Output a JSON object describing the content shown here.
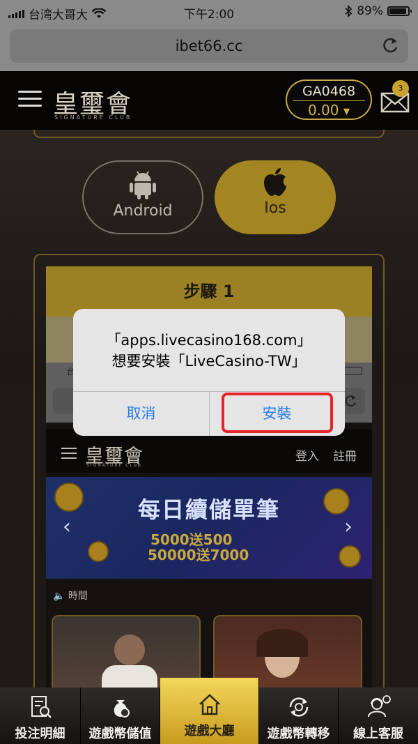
{
  "status_bar": {
    "carrier": "台湾大哥大",
    "time": "下午2:00",
    "battery": "89%"
  },
  "browser": {
    "url": "ibet66.cc"
  },
  "header": {
    "logo": "皇璽會",
    "logo_sub": "SIGNATURE CLUB",
    "account_id": "GA0468",
    "balance": "0.00",
    "mail_count": "3"
  },
  "platform_buttons": [
    {
      "label": "Android",
      "icon": "android-icon"
    },
    {
      "label": "Ios",
      "icon": "apple-icon"
    }
  ],
  "step_title": "步驟 1",
  "inner_screenshot": {
    "status_left": "台",
    "logo": "皇璽會",
    "logo_sub": "SIGNATURE CLUB",
    "login": "登入",
    "register": "註冊",
    "banner_title": "每日續儲單筆",
    "banner_line1": "5000送500",
    "banner_line2": "50000送7000",
    "notice": "時間"
  },
  "dialog": {
    "line1": "「apps.livecasino168.com」",
    "line2": "想要安裝「LiveCasino-TW」",
    "cancel": "取消",
    "install": "安裝"
  },
  "tabs": [
    {
      "label": "投注明細",
      "icon": "bet-detail-icon",
      "active": false
    },
    {
      "label": "遊戲幣儲值",
      "icon": "deposit-icon",
      "active": false
    },
    {
      "label": "遊戲大廳",
      "icon": "home-icon",
      "active": true
    },
    {
      "label": "遊戲幣轉移",
      "icon": "transfer-icon",
      "active": false
    },
    {
      "label": "線上客服",
      "icon": "support-icon",
      "active": false
    }
  ],
  "colors": {
    "gold": "#c8a94a",
    "link_blue": "#2a7be6",
    "highlight_red": "#e5252a"
  }
}
